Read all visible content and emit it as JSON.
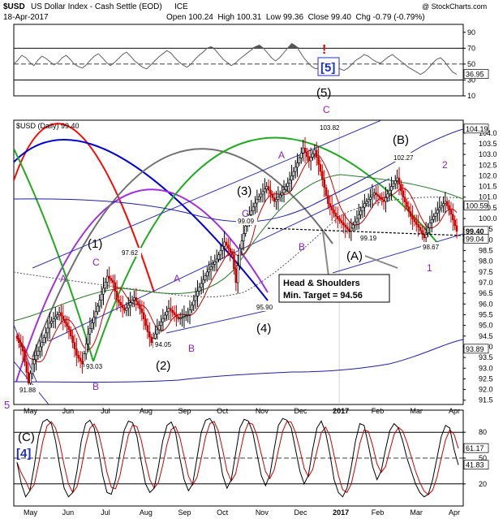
{
  "header": {
    "symbol": "$USD",
    "name": "US Dollar Index - Cash Settle (EOD)",
    "exchange": "ICE",
    "date": "18-Apr-2017",
    "quote": "Open 100.24  High 100.31  Low 99.36  Close 99.40  Chg -0.79 (-0.79%)",
    "watermark": "@ StockCharts.com"
  },
  "chart_data": [
    {
      "panel": "rsi",
      "type": "line",
      "ylim": [
        10,
        100
      ],
      "yticks": [
        "90",
        "70",
        "50",
        "30",
        "10"
      ],
      "reference_lines": [
        70,
        50,
        30
      ],
      "last_value_tag": "36.95",
      "last_value": 36.95,
      "color": "#606060",
      "fill_color": "#555555",
      "values": [
        50,
        55,
        61,
        58,
        52,
        48,
        55,
        60,
        57,
        53,
        49,
        52,
        58,
        61,
        56,
        50,
        47,
        45,
        49,
        55,
        60,
        63,
        58,
        52,
        48,
        52,
        57,
        62,
        65,
        60,
        54,
        50,
        46,
        44,
        49,
        54,
        59,
        63,
        67,
        64,
        58,
        53,
        49,
        46,
        50,
        56,
        61,
        65,
        70,
        72,
        68,
        62,
        56,
        52,
        48,
        51,
        56,
        60,
        64,
        68,
        72,
        74,
        70,
        64,
        58,
        54,
        58,
        64,
        70,
        76,
        73,
        66,
        58,
        52,
        47,
        44,
        46,
        50,
        55,
        53,
        48,
        44,
        42,
        45,
        50,
        55,
        58,
        62,
        60,
        56,
        53,
        51,
        55,
        59,
        62,
        58,
        54,
        50,
        46,
        43,
        40,
        37,
        40,
        45,
        51,
        56,
        58,
        53,
        46,
        40,
        37
      ]
    },
    {
      "panel": "price",
      "type": "candlestick",
      "title": "$USD (Daily) 99.40",
      "ylim": [
        91.3,
        104.6
      ],
      "yticks": [
        "104.0",
        "103.5",
        "103.0",
        "102.5",
        "102.0",
        "101.5",
        "101.0",
        "100.5",
        "100.0",
        "99.5",
        "99.0",
        "98.5",
        "98.0",
        "97.5",
        "97.0",
        "96.5",
        "96.0",
        "95.5",
        "95.0",
        "94.5",
        "94.0",
        "93.5",
        "93.0",
        "92.5",
        "92.0",
        "91.5"
      ],
      "xticks": [
        "May",
        "Jun",
        "Jul",
        "Aug",
        "Sep",
        "Oct",
        "Nov",
        "Dec",
        "2017",
        "Feb",
        "Mar",
        "Apr"
      ],
      "close_points": [
        [
          0,
          94.4
        ],
        [
          3,
          93.8
        ],
        [
          6,
          92.3
        ],
        [
          8,
          93.2
        ],
        [
          13,
          94.2
        ],
        [
          17,
          95.1
        ],
        [
          22,
          95.6
        ],
        [
          27,
          94.8
        ],
        [
          31,
          93.6
        ],
        [
          34,
          93.2
        ],
        [
          37,
          94.6
        ],
        [
          42,
          95.9
        ],
        [
          47,
          97.3
        ],
        [
          50,
          97.0
        ],
        [
          52,
          96.2
        ],
        [
          56,
          95.7
        ],
        [
          61,
          96.3
        ],
        [
          65,
          95.6
        ],
        [
          68,
          94.7
        ],
        [
          70,
          94.2
        ],
        [
          74,
          95.0
        ],
        [
          79,
          95.8
        ],
        [
          84,
          95.3
        ],
        [
          89,
          95.5
        ],
        [
          94,
          96.6
        ],
        [
          99,
          97.5
        ],
        [
          104,
          98.1
        ],
        [
          108,
          98.9
        ],
        [
          112,
          98.3
        ],
        [
          114,
          97.0
        ],
        [
          116,
          98.6
        ],
        [
          120,
          100.0
        ],
        [
          125,
          100.9
        ],
        [
          130,
          101.5
        ],
        [
          134,
          100.8
        ],
        [
          138,
          101.2
        ],
        [
          142,
          101.8
        ],
        [
          146,
          102.6
        ],
        [
          149,
          103.3
        ],
        [
          152,
          102.7
        ],
        [
          155,
          103.2
        ],
        [
          158,
          102.2
        ],
        [
          162,
          100.7
        ],
        [
          166,
          100.1
        ],
        [
          170,
          99.7
        ],
        [
          173,
          99.4
        ],
        [
          177,
          100.0
        ],
        [
          181,
          100.7
        ],
        [
          186,
          101.2
        ],
        [
          191,
          100.8
        ],
        [
          195,
          101.5
        ],
        [
          198,
          101.9
        ],
        [
          201,
          101.0
        ],
        [
          205,
          100.1
        ],
        [
          209,
          99.6
        ],
        [
          212,
          99.1
        ],
        [
          215,
          99.8
        ],
        [
          219,
          100.4
        ],
        [
          223,
          100.8
        ],
        [
          226,
          100.2
        ],
        [
          229,
          99.4
        ]
      ],
      "last_close": 99.4,
      "last_high": 100.31,
      "last_low": 99.36,
      "price_tags": [
        {
          "text": "104.19",
          "value": 104.19
        },
        {
          "text": "100.59",
          "value": 100.59
        },
        {
          "text": "99.40",
          "value": 99.4
        },
        {
          "text": "99.04",
          "value": 99.04
        },
        {
          "text": "93.89",
          "value": 93.89
        }
      ],
      "point_labels": [
        "91.88",
        "93.03",
        "97.62",
        "94.05",
        "99.09",
        "95.90",
        "103.82",
        "99.19",
        "102.27",
        "98.67"
      ],
      "wave_labels": [
        "(1)",
        "(2)",
        "(3)",
        "(4)",
        "(5)",
        "[5]",
        "(A)",
        "(B)",
        "A",
        "B",
        "C",
        "A",
        "B",
        "C",
        "A",
        "B",
        "C",
        "1",
        "2"
      ],
      "callout": {
        "title": "Head & Shoulders",
        "subtitle": "Min. Target = 94.56"
      },
      "colors": {
        "up": "#000000",
        "down": "#cc0000",
        "ma_short": "#cc0000",
        "ma_long": "#2a7a2a",
        "bands": "#1f1fa0",
        "trend": "#3333aa"
      }
    },
    {
      "panel": "stochastic",
      "type": "line",
      "ylim": [
        0,
        100
      ],
      "yticks": [
        "80",
        "50",
        "20"
      ],
      "reference_lines": [
        80,
        50,
        20
      ],
      "last_value_tags": [
        "61.17",
        "41.83"
      ],
      "k_last": 41.83,
      "d_last": 61.17,
      "colors": {
        "k": "#000000",
        "d": "#cc0000"
      },
      "left_labels": [
        "(C)",
        "[4]"
      ],
      "k_values": [
        45,
        20,
        5,
        12,
        40,
        75,
        92,
        95,
        90,
        70,
        40,
        15,
        5,
        10,
        35,
        70,
        90,
        94,
        85,
        60,
        30,
        10,
        8,
        25,
        55,
        82,
        93,
        91,
        75,
        45,
        20,
        10,
        15,
        40,
        70,
        88,
        92,
        80,
        50,
        25,
        12,
        20,
        50,
        80,
        94,
        96,
        88,
        60,
        30,
        15,
        25,
        55,
        85,
        95,
        93,
        80,
        55,
        30,
        18,
        30,
        60,
        88,
        96,
        94,
        85,
        60,
        35,
        20,
        30,
        60,
        85,
        93,
        80,
        55,
        25,
        10,
        5,
        15,
        40,
        70,
        90,
        88,
        65,
        40,
        25,
        35,
        60,
        82,
        90,
        85,
        70,
        50,
        35,
        20,
        10,
        5,
        8,
        25,
        50,
        75,
        88,
        85,
        60,
        42
      ]
    }
  ]
}
